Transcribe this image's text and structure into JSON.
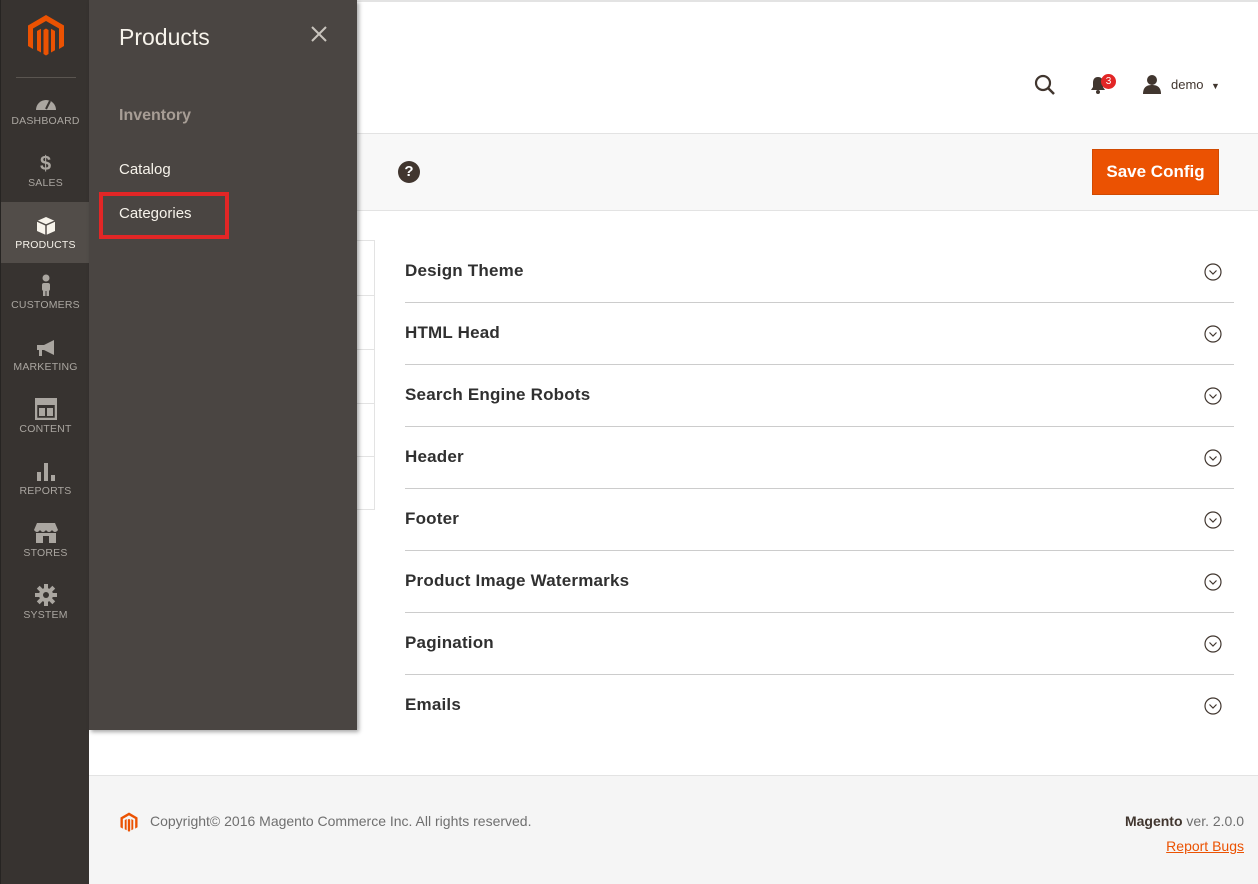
{
  "sidebar": {
    "items": [
      {
        "label": "DASHBOARD",
        "icon": "dashboard-icon"
      },
      {
        "label": "SALES",
        "icon": "dollar-icon"
      },
      {
        "label": "PRODUCTS",
        "icon": "box-icon",
        "active": true
      },
      {
        "label": "CUSTOMERS",
        "icon": "person-icon"
      },
      {
        "label": "MARKETING",
        "icon": "megaphone-icon"
      },
      {
        "label": "CONTENT",
        "icon": "layout-icon"
      },
      {
        "label": "REPORTS",
        "icon": "bar-chart-icon"
      },
      {
        "label": "STORES",
        "icon": "store-icon"
      },
      {
        "label": "SYSTEM",
        "icon": "gear-icon"
      }
    ]
  },
  "flyout": {
    "title": "Products",
    "section": "Inventory",
    "links": [
      "Catalog",
      "Categories"
    ]
  },
  "header": {
    "notification_count": "3",
    "user": "demo"
  },
  "action_bar": {
    "save_label": "Save Config"
  },
  "sections": [
    "Design Theme",
    "HTML Head",
    "Search Engine Robots",
    "Header",
    "Footer",
    "Product Image Watermarks",
    "Pagination",
    "Emails"
  ],
  "footer": {
    "copyright": "Copyright© 2016 Magento Commerce Inc. All rights reserved.",
    "brand": "Magento",
    "version": " ver. 2.0.0",
    "report_bugs": "Report Bugs"
  },
  "colors": {
    "accent": "#eb5202",
    "sidebar": "#373330",
    "flyout": "#4a4542",
    "highlight": "#e22626"
  }
}
